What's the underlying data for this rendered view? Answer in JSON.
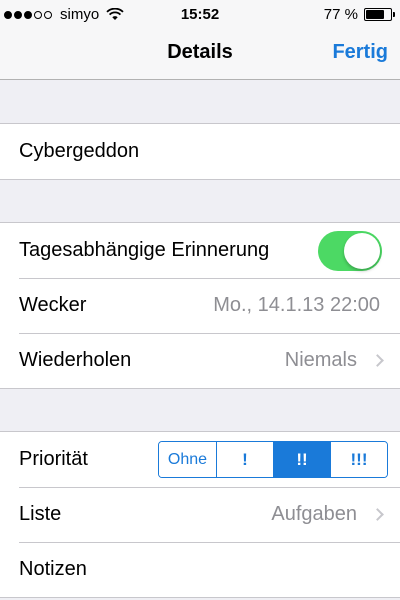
{
  "status_bar": {
    "carrier": "simyo",
    "time": "15:52",
    "battery": "77 %",
    "battery_level": 0.77,
    "signal_dots_filled": 3,
    "signal_dots_total": 5
  },
  "navbar": {
    "title": "Details",
    "done_label": "Fertig"
  },
  "task": {
    "title": "Cybergeddon"
  },
  "reminder": {
    "day_reminder_label": "Tagesabhängige Erinnerung",
    "day_reminder_on": true,
    "alarm_label": "Wecker",
    "alarm_value": "Mo., 14.1.13 22:00",
    "repeat_label": "Wiederholen",
    "repeat_value": "Niemals"
  },
  "details": {
    "priority_label": "Priorität",
    "priority_options": [
      "Ohne",
      "!",
      "!!",
      "!!!"
    ],
    "priority_selected": 2,
    "list_label": "Liste",
    "list_value": "Aufgaben",
    "notes_label": "Notizen"
  },
  "colors": {
    "accent": "#1a7ad9",
    "toggle_on": "#4cd964",
    "background": "#efeff4"
  }
}
